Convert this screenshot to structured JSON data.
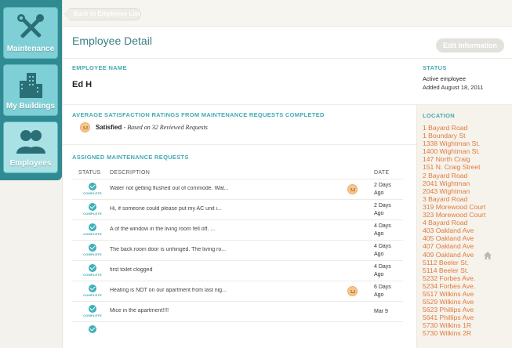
{
  "sidebar": {
    "items": [
      {
        "label": "Maintenance",
        "icon": "tools-icon"
      },
      {
        "label": "My Buildings",
        "icon": "buildings-icon"
      },
      {
        "label": "Employees",
        "icon": "people-icon"
      }
    ],
    "active": "Employees"
  },
  "topbar": {
    "back_label": "Back to Employee List"
  },
  "page": {
    "title": "Employee Detail",
    "edit_label": "Edit Information"
  },
  "employee": {
    "name_label": "EMPLOYEE NAME",
    "name": "Ed H",
    "status_label": "STATUS",
    "status": "Active employee",
    "added": "Added August 18, 2011"
  },
  "satisfaction": {
    "label": "AVERAGE SATISFACTION RATINGS FROM MAINTENANCE REQUESTS COMPLETED",
    "rating": "Satisfied",
    "detail": "- Based on 32 Reviewed Requests"
  },
  "requests": {
    "label": "ASSIGNED MAINTENANCE REQUESTS",
    "columns": {
      "status": "STATUS",
      "description": "DESCRIPTION",
      "date": "DATE"
    },
    "complete_label": "COMPLETE",
    "rows": [
      {
        "description": "Water not getting flushed out of commode. Wat...",
        "date": "2 Days Ago",
        "rated": true
      },
      {
        "description": "Hi, if someone could please put my AC unit i...",
        "date": "2 Days Ago",
        "rated": false
      },
      {
        "description": "A of the window in the living room fell off. ...",
        "date": "4 Days Ago",
        "rated": false
      },
      {
        "description": "The back room door is unhinged. The living ro...",
        "date": "4 Days Ago",
        "rated": false
      },
      {
        "description": "first toilet clogged",
        "date": "4 Days Ago",
        "rated": false
      },
      {
        "description": "Heating is NOT on our apartment from last nig...",
        "date": "6 Days Ago",
        "rated": true
      },
      {
        "description": "Mice in the apartment!!!!",
        "date": "Mar 9",
        "rated": false
      }
    ]
  },
  "location": {
    "label": "LOCATION",
    "items": [
      "1 Bayard Road",
      "1 Boundary St",
      "1338 Wightman St.",
      "1400 Wightman St.",
      "147 North Craig",
      "151 N. Craig Street",
      "2 Bayard Road",
      "2041 Wightman",
      "2043 Wightman",
      "3 Bayard Road",
      "319 Morewood Court",
      "323 Morewood Court",
      "4 Bayard Road",
      "403 Oakland Ave",
      "405 Oakland Ave",
      "407 Oakland Ave",
      "409 Oakland Ave",
      "5112 Beeler St.",
      "5114 Beeler St.",
      "5232 Forbes Ave.",
      "5234 Forbes Ave.",
      "5517 Wilkins Ave",
      "5529 Wilkins Ave",
      "5623 Phillips Ave",
      "5641 Phillips Ave",
      "5730 Wilkins 1R",
      "5730 Wilkins 2R"
    ]
  },
  "colors": {
    "accent": "#3fb0ba",
    "sidebar": "#2f8a91",
    "location": "#e07a3d"
  }
}
